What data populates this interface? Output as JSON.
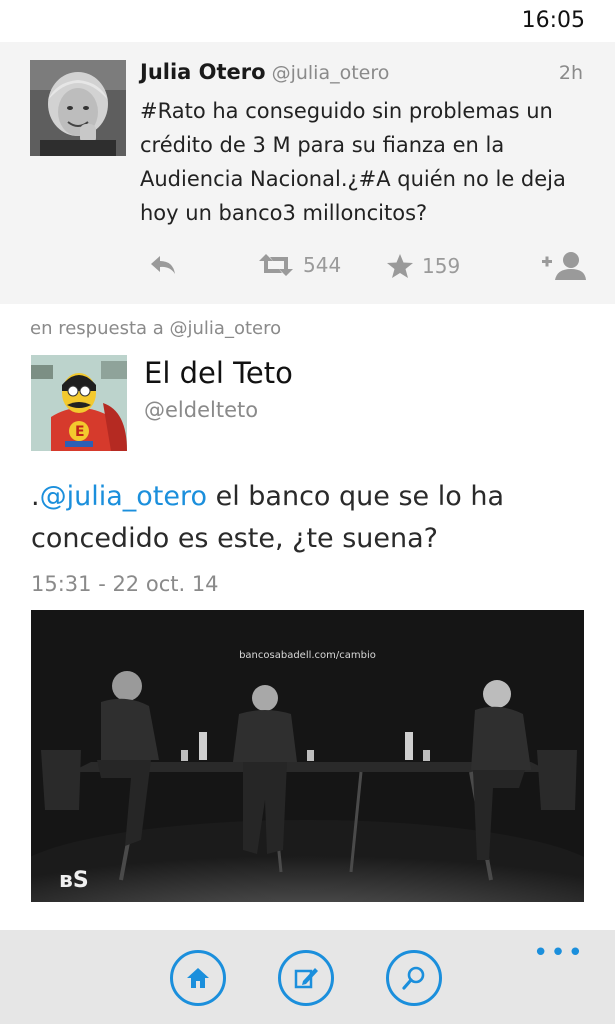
{
  "status_bar": {
    "time": "16:05"
  },
  "parent_tweet": {
    "name": "Julia Otero",
    "handle": "@julia_otero",
    "age": "2h",
    "text": "#Rato ha conseguido sin problemas un crédito de 3 M para su fianza en la Audiencia Nacional.¿#A quién no le deja hoy un banco3 milloncitos?",
    "retweets": "544",
    "favorites": "159",
    "icons": {
      "reply": "reply-icon",
      "retweet": "retweet-icon",
      "favorite": "star-icon",
      "follow": "add-user-icon"
    }
  },
  "reply_context": "en respuesta a @julia_otero",
  "main_tweet": {
    "name": "El del Teto",
    "handle": "@eldelteto",
    "prefix": ".",
    "mention": "@julia_otero",
    "text_rest": " el banco que se lo ha concedido es este, ¿te suena?",
    "timestamp": "15:31 - 22 oct. 14",
    "media": {
      "url_text": "bancosabadell.com/cambio",
      "logo": "ʙS"
    }
  },
  "app_bar": {
    "buttons": [
      "home-icon",
      "compose-icon",
      "search-icon"
    ],
    "more": "•••"
  },
  "colors": {
    "accent": "#1b8fdc",
    "panel": "#f4f4f4",
    "appbar": "#e6e6e6",
    "muted": "#8a8a8a"
  }
}
